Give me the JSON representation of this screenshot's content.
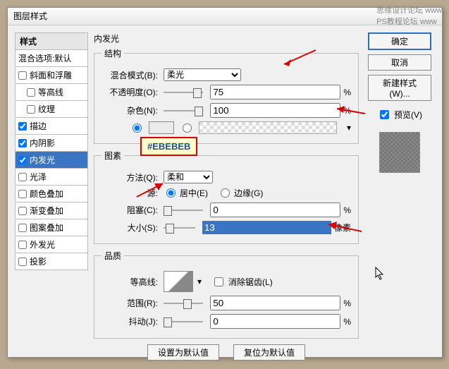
{
  "watermark": "PS教程论坛 www",
  "watermark2": "思缘设计论坛 www",
  "dialog_title": "图层样式",
  "styles_header": "样式",
  "styles_items": [
    {
      "label": "混合选项:默认",
      "checked": false,
      "no_checkbox": true
    },
    {
      "label": "斜面和浮雕",
      "checked": false
    },
    {
      "label": "等高线",
      "checked": false,
      "indent": true
    },
    {
      "label": "纹理",
      "checked": false,
      "indent": true
    },
    {
      "label": "描边",
      "checked": true
    },
    {
      "label": "内阴影",
      "checked": true
    },
    {
      "label": "内发光",
      "checked": true,
      "selected": true
    },
    {
      "label": "光泽",
      "checked": false
    },
    {
      "label": "颜色叠加",
      "checked": false
    },
    {
      "label": "渐变叠加",
      "checked": false
    },
    {
      "label": "图案叠加",
      "checked": false
    },
    {
      "label": "外发光",
      "checked": false
    },
    {
      "label": "投影",
      "checked": false
    }
  ],
  "panel_title": "内发光",
  "structure": {
    "legend": "结构",
    "blend_label": "混合模式(B):",
    "blend_value": "柔光",
    "opacity_label": "不透明度(O):",
    "opacity_value": "75",
    "noise_label": "杂色(N):",
    "noise_value": "100",
    "percent": "%",
    "color_note": "#EBEBEB"
  },
  "elements": {
    "legend": "图素",
    "technique_label": "方法(Q):",
    "technique_value": "柔和",
    "source_label": "源:",
    "source_center": "居中(E)",
    "source_edge": "边缘(G)",
    "choke_label": "阻塞(C):",
    "choke_value": "0",
    "size_label": "大小(S):",
    "size_value": "13",
    "px": "像素"
  },
  "quality": {
    "legend": "品质",
    "contour_label": "等高线:",
    "anti_alias": "消除锯齿(L)",
    "range_label": "范围(R):",
    "range_value": "50",
    "jitter_label": "抖动(J):",
    "jitter_value": "0"
  },
  "buttons": {
    "make_default": "设置为默认值",
    "reset_default": "复位为默认值",
    "ok": "确定",
    "cancel": "取消",
    "new_style": "新建样式(W)...",
    "preview": "预览(V)"
  }
}
